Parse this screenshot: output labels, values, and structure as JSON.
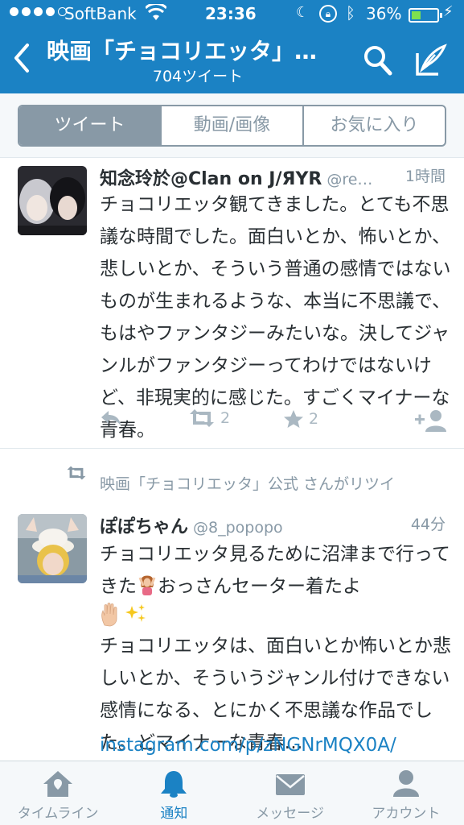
{
  "status_bar": {
    "carrier": "SoftBank",
    "time": "23:36",
    "battery_percent": "36%",
    "battery_level": 0.36
  },
  "nav": {
    "title": "映画「チョコリエッタ」…",
    "subtitle": "704ツイート"
  },
  "segments": [
    {
      "label": "ツイート",
      "active": true
    },
    {
      "label": "動画/画像",
      "active": false
    },
    {
      "label": "お気に入り",
      "active": false
    }
  ],
  "tweets": [
    {
      "name": "知念玲於@Clan on J/ЯYR",
      "handle": "@re…",
      "time": "1時間",
      "text": "チョコリエッタ観てきました。とても不思議な時間でした。面白いとか、怖いとか、悲しいとか、そういう普通の感情ではないものが生まれるような、本当に不思議で、もはやファンタジーみたいな。決してジャンルがファンタジーってわけではないけど、非現実的に感じた。すごくマイナーな青春。",
      "retweets": "2",
      "favorites": "2"
    },
    {
      "retweeted_by": "映画「チョコリエッタ」公式 さんがリツイ",
      "name": "ぽぽちゃん",
      "handle": "@8_popopo",
      "time": "44分",
      "text_1": "チョコリエッタ見るために沼津まで行ってきた",
      "text_1b": "おっさんセーター着たよ",
      "emoji_line": "✋✨",
      "text_2": "チョコリエッタは、面白いとか怖いとか悲しいとか、そういうジャンル付けできない感情になる、とにかく不思議な作品でした。どマイナーな青春…",
      "link": "instagram.com/p/zNGNrMQX0A/"
    }
  ],
  "tabbar": [
    {
      "label": "タイムライン",
      "icon": "home-icon",
      "active": false
    },
    {
      "label": "通知",
      "icon": "bell-icon",
      "active": true
    },
    {
      "label": "メッセージ",
      "icon": "envelope-icon",
      "active": false
    },
    {
      "label": "アカウント",
      "icon": "person-icon",
      "active": false
    }
  ],
  "colors": {
    "brand": "#1b82c4",
    "muted": "#8899a6",
    "battery_fill": "#7ee04f"
  }
}
